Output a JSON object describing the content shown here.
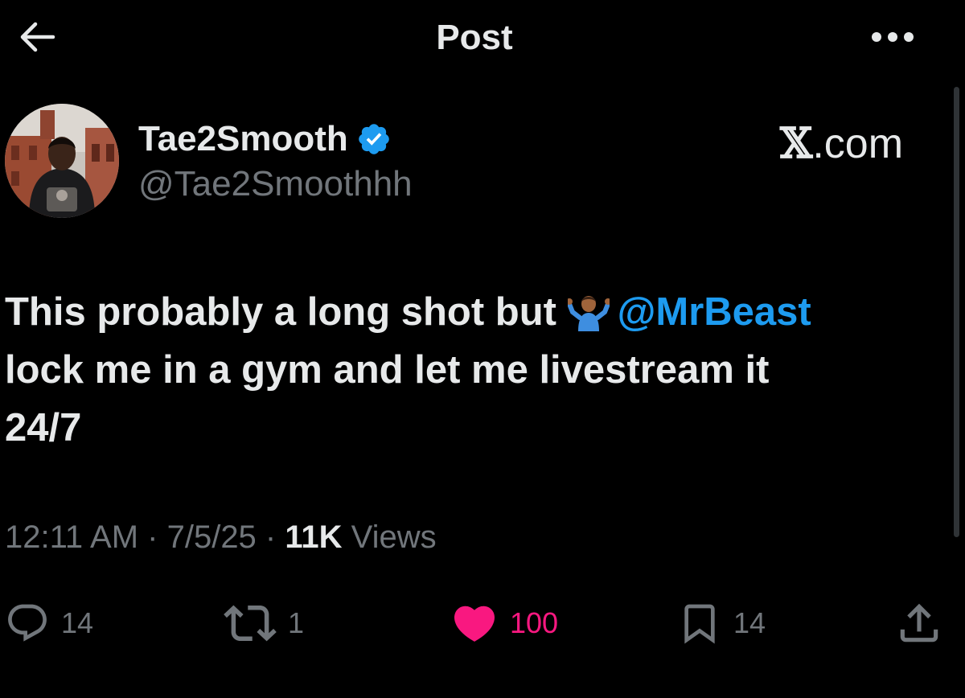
{
  "header": {
    "title": "Post",
    "back_icon": "arrow-left-icon",
    "more_icon": "more-horizontal-icon"
  },
  "author": {
    "display_name": "Tae2Smooth",
    "handle": "@Tae2Smoothhh",
    "verified": true,
    "verified_color": "#1d9bf0"
  },
  "source_label": {
    "x": "𝕏",
    "rest": ".com"
  },
  "post": {
    "line1_text": "This probably a long shot but ",
    "emoji": "🤷🏾‍♂️",
    "mention": "@MrBeast",
    "line2_text": "lock me in a gym and let me livestream it",
    "line3_text": "24/7"
  },
  "meta": {
    "time": "12:11 AM",
    "separator": " · ",
    "date": "7/5/25",
    "views_count": "11K",
    "views_label": " Views"
  },
  "actions": {
    "replies": "14",
    "reposts": "1",
    "likes": "100",
    "bookmarks": "14",
    "like_color": "#f91880",
    "icons": [
      "reply-icon",
      "repost-icon",
      "heart-icon",
      "bookmark-icon",
      "share-icon"
    ]
  },
  "colors": {
    "background": "#000000",
    "text_primary": "#e7e9ea",
    "text_secondary": "#71767b",
    "link": "#1d9bf0"
  }
}
